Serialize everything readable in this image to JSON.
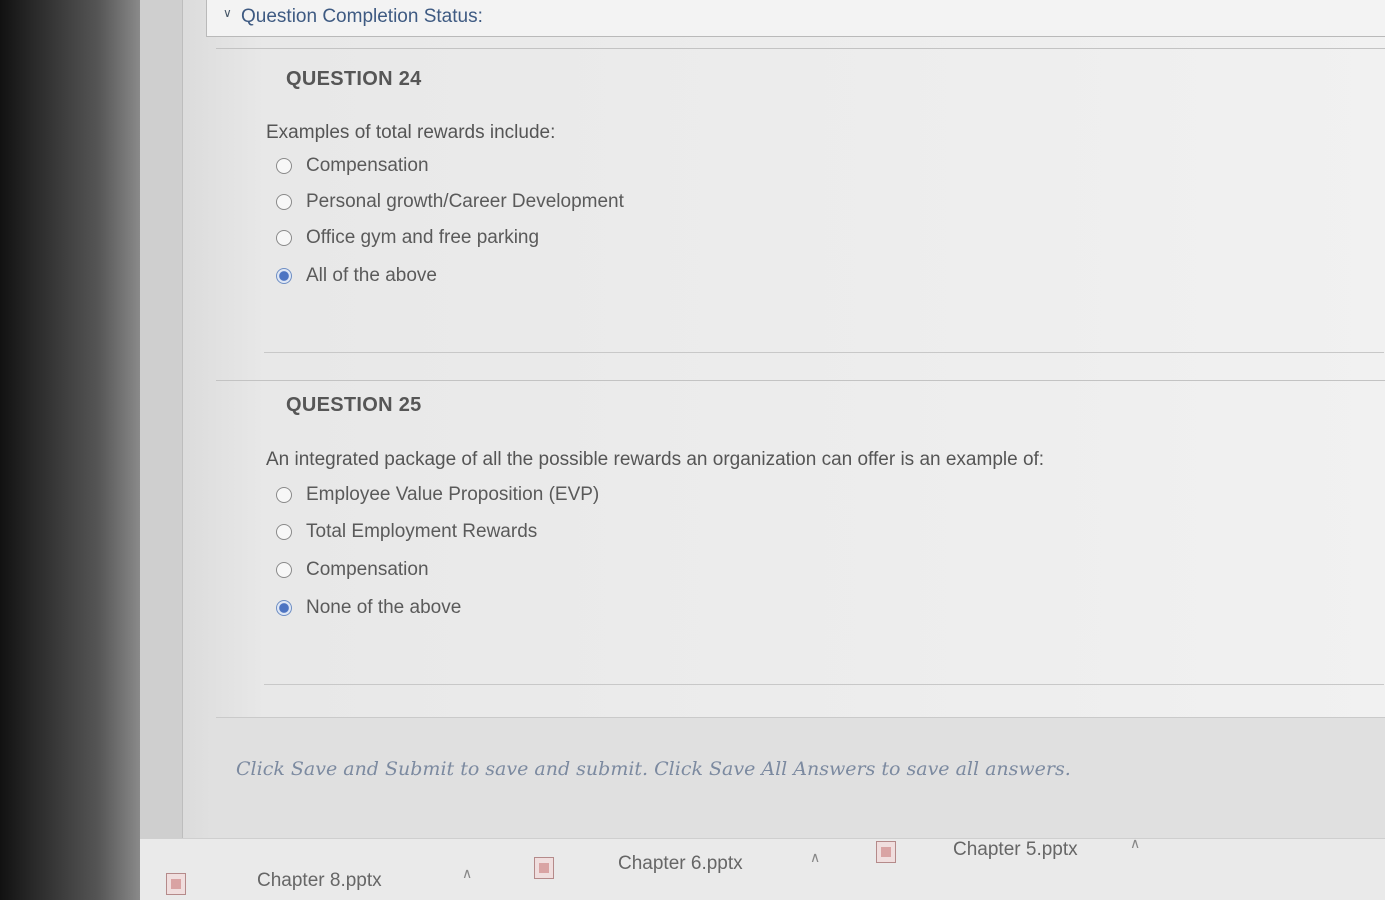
{
  "status": {
    "title": "Question Completion Status:"
  },
  "questions": [
    {
      "title": "QUESTION 24",
      "text": "Examples of total rewards include:",
      "options": [
        {
          "label": "Compensation",
          "selected": false
        },
        {
          "label": "Personal growth/Career Development",
          "selected": false
        },
        {
          "label": "Office gym and free parking",
          "selected": false
        },
        {
          "label": "All of the above",
          "selected": true
        }
      ]
    },
    {
      "title": "QUESTION 25",
      "text": "An integrated package of all the possible rewards an organization can offer is an example of:",
      "options": [
        {
          "label": "Employee Value Proposition (EVP)",
          "selected": false
        },
        {
          "label": "Total Employment Rewards",
          "selected": false
        },
        {
          "label": "Compensation",
          "selected": false
        },
        {
          "label": "None of the above",
          "selected": true
        }
      ]
    }
  ],
  "footer": {
    "instructions": "Click Save and Submit to save and submit. Click Save All Answers to save all answers."
  },
  "downloads": [
    {
      "name": "Chapter 8.pptx",
      "icon": "powerpoint-file-icon"
    },
    {
      "name": "Chapter 6.pptx",
      "icon": "powerpoint-file-icon"
    },
    {
      "name": "Chapter 5.pptx",
      "icon": "powerpoint-file-icon"
    }
  ],
  "colors": {
    "link": "#3e5a82",
    "radio_selected": "#4d74c2"
  }
}
